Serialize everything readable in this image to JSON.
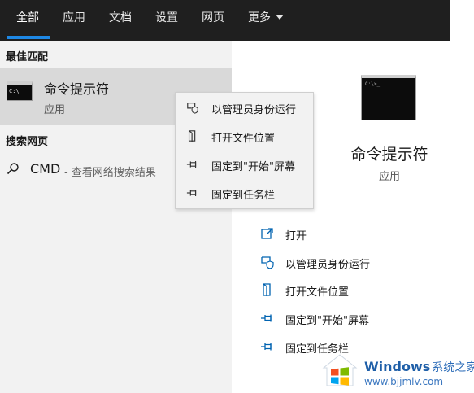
{
  "tabs": [
    {
      "label": "全部"
    },
    {
      "label": "应用"
    },
    {
      "label": "文档"
    },
    {
      "label": "设置"
    },
    {
      "label": "网页"
    },
    {
      "label": "更多"
    }
  ],
  "sections": {
    "best_match_title": "最佳匹配",
    "web_search_title": "搜索网页"
  },
  "best_match": {
    "name": "命令提示符",
    "type": "应用",
    "icon": "cmd-icon",
    "icon_text": "C:\\_"
  },
  "web_result": {
    "query": "CMD",
    "hint": "- 查看网络搜索结果",
    "icon": "search-icon"
  },
  "context_menu": {
    "items": [
      {
        "label": "以管理员身份运行",
        "icon": "shield-icon"
      },
      {
        "label": "打开文件位置",
        "icon": "file-location-icon"
      },
      {
        "label": "固定到\"开始\"屏幕",
        "icon": "pin-icon"
      },
      {
        "label": "固定到任务栏",
        "icon": "pin-icon"
      }
    ]
  },
  "details": {
    "title": "命令提示符",
    "type": "应用",
    "icon_text": "C:\\>_",
    "actions": [
      {
        "label": "打开",
        "icon": "open-icon"
      },
      {
        "label": "以管理员身份运行",
        "icon": "shield-icon"
      },
      {
        "label": "打开文件位置",
        "icon": "file-location-icon"
      },
      {
        "label": "固定到\"开始\"屏幕",
        "icon": "pin-icon"
      },
      {
        "label": "固定到任务栏",
        "icon": "pin-icon"
      }
    ]
  },
  "watermark": {
    "brand": "Windows",
    "brand_cn": "系统之家",
    "url": "www.bjjmlv.com"
  },
  "colors": {
    "topbar": "#1f1f1f",
    "accent": "#1e88e5",
    "selected_row": "#d9d9d9",
    "pane_bg": "#f2f2f2",
    "icon_blue": "#0063b1"
  }
}
